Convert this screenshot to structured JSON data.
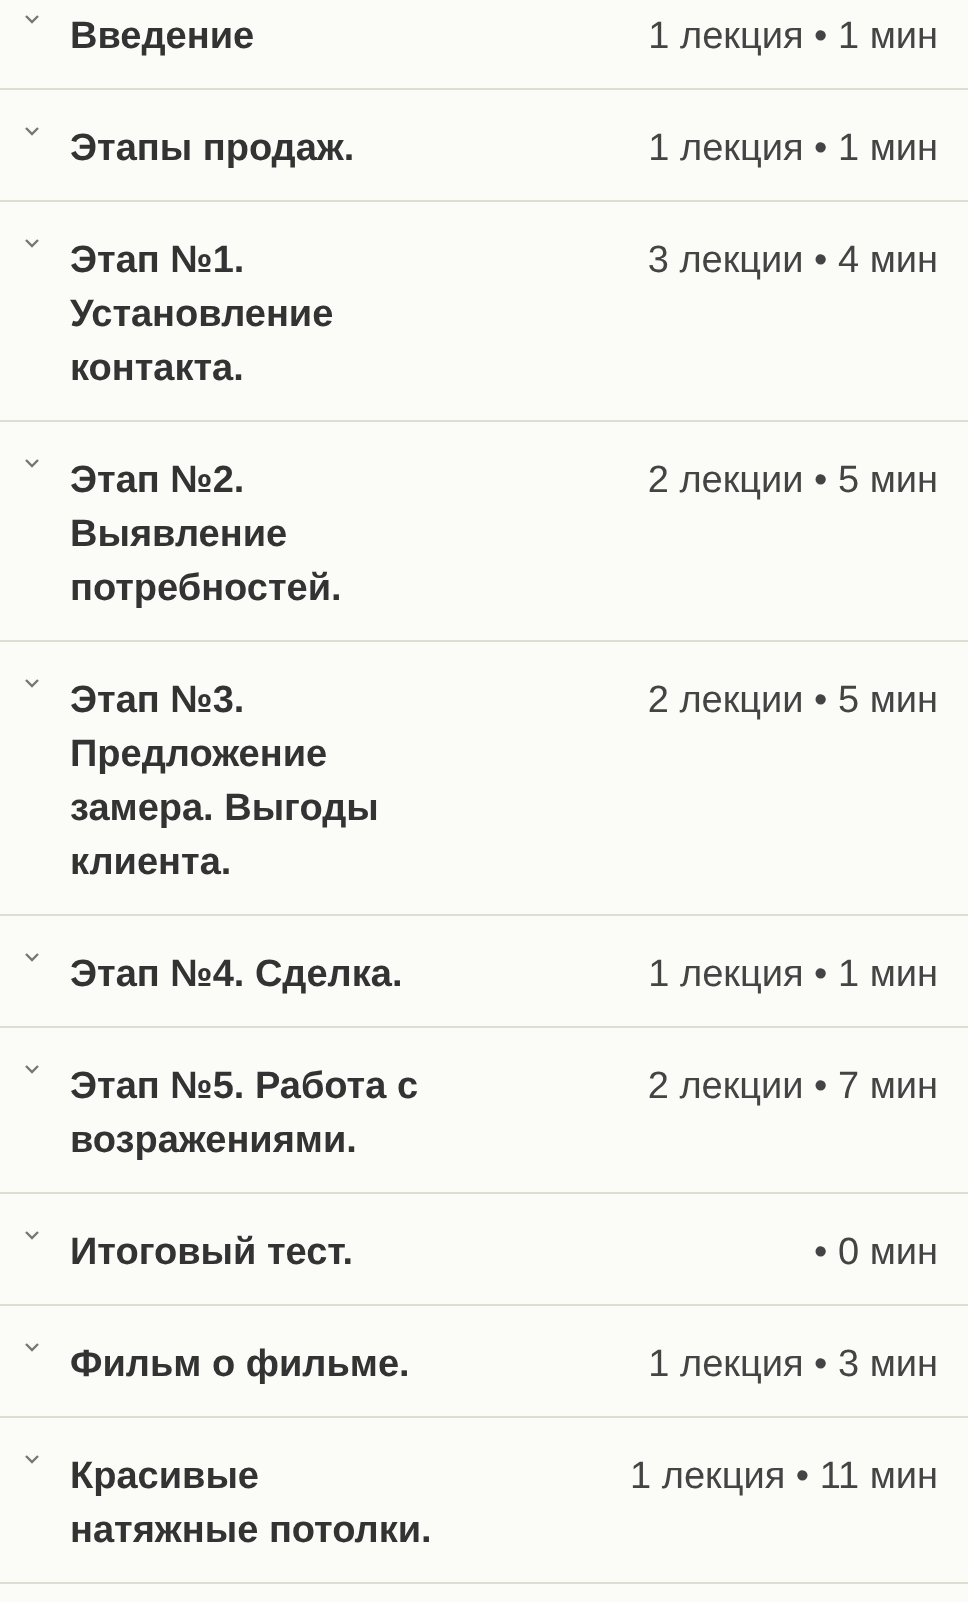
{
  "sections": [
    {
      "title": "Введение",
      "meta": "1 лекция • 1 мин",
      "expanded": false
    },
    {
      "title": "Этапы продаж.",
      "meta": "1 лекция • 1 мин",
      "expanded": false
    },
    {
      "title": "Этап №1. Установление контакта.",
      "meta": "3 лекции • 4 мин",
      "expanded": false
    },
    {
      "title": "Этап №2. Выявление потребностей.",
      "meta": "2 лекции • 5 мин",
      "expanded": false
    },
    {
      "title": "Этап №3. Предложение замера. Выгоды клиента.",
      "meta": "2 лекции • 5 мин",
      "expanded": false
    },
    {
      "title": "Этап №4. Сделка.",
      "meta": "1 лекция • 1 мин",
      "expanded": false
    },
    {
      "title": "Этап №5. Работа с возражениями.",
      "meta": "2 лекции • 7 мин",
      "expanded": false
    },
    {
      "title": "Итоговый тест.",
      "meta": "• 0 мин",
      "expanded": false
    },
    {
      "title": "Фильм о фильме.",
      "meta": "1 лекция • 3 мин",
      "expanded": false
    },
    {
      "title": "Красивые натяжные потолки.",
      "meta": "1 лекция • 11 мин",
      "expanded": false
    }
  ]
}
